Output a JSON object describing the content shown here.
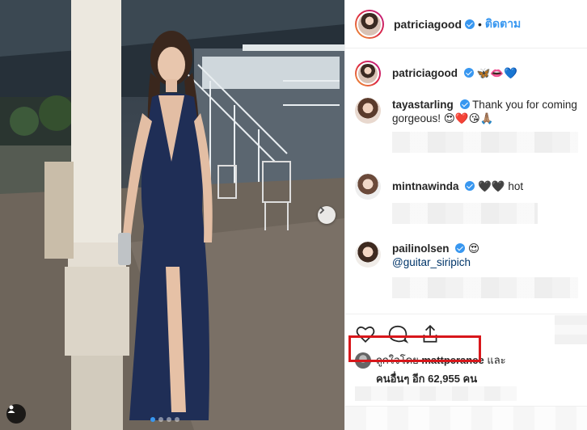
{
  "post": {
    "author": "patriciagood",
    "follow_label": "ติดตาม",
    "bullet": "•",
    "caption_emoji": "🦋👄💙"
  },
  "comments": [
    {
      "user": "tayastarling",
      "text": "Thank you for coming gorgeous! 😍❤️😘🙏🏽"
    },
    {
      "user": "mintnawinda",
      "text": "🖤🖤 hot"
    },
    {
      "user": "pailinolsen",
      "text": "😍",
      "mention": "@guitar_siripich"
    }
  ],
  "likes": {
    "prefix": "ถูกใจโดย",
    "user": "mattperanee",
    "suffix": "และ",
    "line2": "คนอื่นๆ อีก 62,955 คน"
  },
  "icons": [
    "heart-icon",
    "comment-icon",
    "share-icon",
    "chevron-right-icon",
    "user-tag-icon"
  ],
  "colors": {
    "accent": "#3897f0",
    "highlight": "#d8171b"
  }
}
